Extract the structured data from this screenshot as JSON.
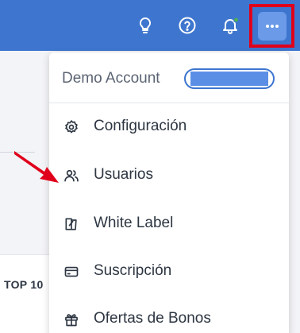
{
  "topbar": {
    "icons": [
      "lightbulb-icon",
      "help-circle-icon",
      "bell-icon",
      "more-dots-icon"
    ],
    "notification_dot_color": "#4caf50",
    "bar_color": "#3e76cf"
  },
  "background": {
    "section_label": "TOP 10"
  },
  "menu": {
    "account_name": "Demo Account",
    "items": [
      {
        "label": "Configuración",
        "icon": "gear-icon"
      },
      {
        "label": "Usuarios",
        "icon": "users-icon"
      },
      {
        "label": "White Label",
        "icon": "white-label-icon"
      },
      {
        "label": "Suscripción",
        "icon": "credit-card-icon"
      },
      {
        "label": "Ofertas de Bonos",
        "icon": "gift-icon"
      }
    ]
  },
  "annotation": {
    "highlight_color": "#e0001b"
  }
}
